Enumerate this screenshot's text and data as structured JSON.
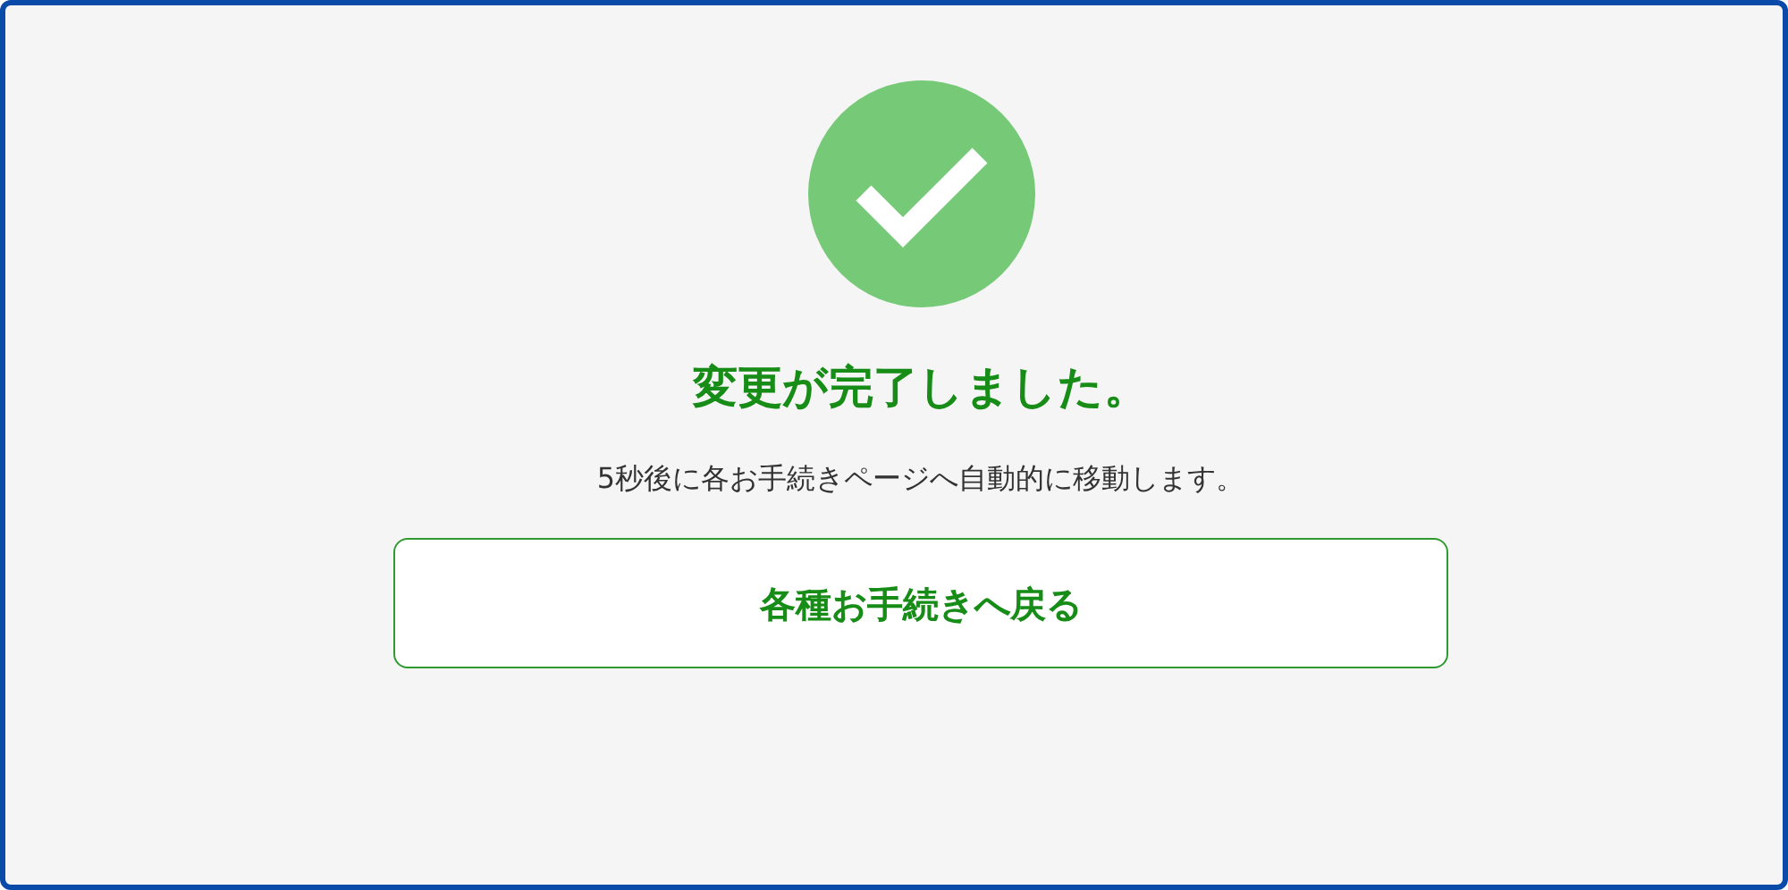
{
  "status": {
    "kind": "success"
  },
  "title": "変更が完了しました。",
  "message": "5秒後に各お手続きページへ自動的に移動します。",
  "button": {
    "label": "各種お手続きへ戻る"
  }
}
